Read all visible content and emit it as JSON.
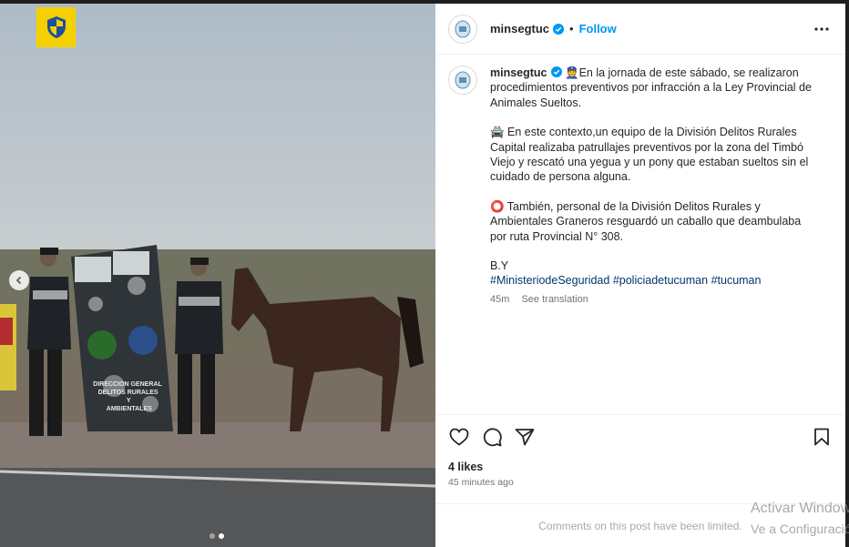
{
  "post": {
    "username": "minsegtuc",
    "follow_label": "Follow",
    "separator": "•",
    "caption_lines": [
      "👮En la jornada de este sábado, se realizaron procedimientos preventivos por infracción a la Ley Provincial de Animales Sueltos.",
      "🚔 En este contexto,un equipo de la División Delitos Rurales Capital realizaba patrullajes preventivos por la zona del Timbó Viejo y rescató una yegua y un pony que estaban sueltos sin el cuidado de persona alguna.",
      "⭕ También, personal de la División Delitos Rurales y Ambientales Graneros resguardó un caballo que deambulaba por ruta Provincial N° 308."
    ],
    "signature": "B.Y",
    "hashtags": [
      "#MinisteriodeSeguridad",
      "#policiadetucuman",
      "#tucuman"
    ],
    "age": "45m",
    "see_translation": "See translation",
    "likes": "4 likes",
    "time_ago": "45 minutes ago",
    "comments_limited": "Comments on this post have been limited."
  },
  "photo": {
    "banner_lines": [
      "DIRECCION GENERAL",
      "DELITOS RURALES",
      "Y",
      "AMBIENTALES"
    ],
    "carousel": {
      "count": 2,
      "active_index": 1
    }
  },
  "watermark": {
    "line1": "Activar Windows",
    "line2": "Ve a Configuración"
  },
  "icons": [
    "shield-icon",
    "chevron-left-icon",
    "verified-icon",
    "more-icon",
    "heart-icon",
    "comment-icon",
    "share-icon",
    "bookmark-icon"
  ],
  "colors": {
    "follow": "#0095f6",
    "hashtag": "#00376b",
    "badge": "#f4d000"
  }
}
